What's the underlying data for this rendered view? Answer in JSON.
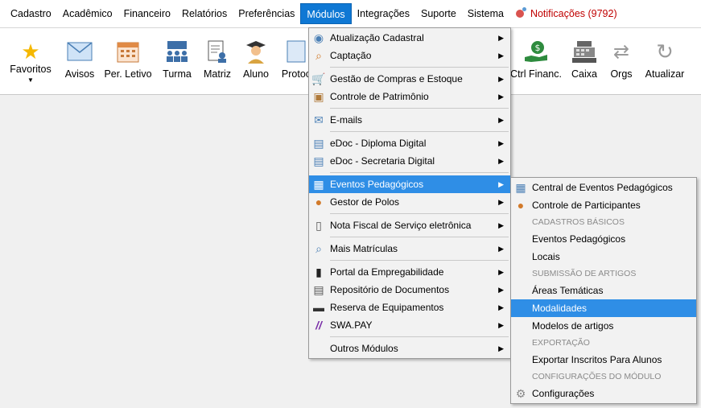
{
  "menubar": {
    "items": [
      "Cadastro",
      "Acadêmico",
      "Financeiro",
      "Relatórios",
      "Preferências",
      "Módulos",
      "Integrações",
      "Suporte",
      "Sistema"
    ],
    "notifications": "Notificações (9792)"
  },
  "toolbar": {
    "buttons": [
      {
        "label": "Favoritos",
        "icon": "star-icon"
      },
      {
        "label": "Avisos",
        "icon": "envelope-icon"
      },
      {
        "label": "Per. Letivo",
        "icon": "calendar-icon"
      },
      {
        "label": "Turma",
        "icon": "classroom-icon"
      },
      {
        "label": "Matriz",
        "icon": "document-user-icon"
      },
      {
        "label": "Aluno",
        "icon": "student-icon"
      },
      {
        "label": "Protoc",
        "icon": "protocol-icon"
      },
      {
        "label": "Ctrl Financ.",
        "icon": "money-hand-icon"
      },
      {
        "label": "Caixa",
        "icon": "cash-register-icon"
      },
      {
        "label": "Orgs",
        "icon": "swap-icon"
      },
      {
        "label": "Atualizar",
        "icon": "refresh-icon"
      }
    ]
  },
  "modulos_menu": {
    "items": [
      {
        "label": "Atualização Cadastral",
        "icon": "database-icon",
        "submenu": true
      },
      {
        "label": "Captação",
        "icon": "magnifier-icon",
        "submenu": true
      },
      {
        "label": "Gestão de Compras e Estoque",
        "icon": "cart-icon",
        "submenu": true
      },
      {
        "label": "Controle de Patrimônio",
        "icon": "box-icon",
        "submenu": true
      },
      {
        "label": "E-mails",
        "icon": "mail-icon",
        "submenu": true
      },
      {
        "label": "eDoc - Diploma Digital",
        "icon": "edoc-icon",
        "submenu": true
      },
      {
        "label": "eDoc - Secretaria Digital",
        "icon": "edoc-icon",
        "submenu": true
      },
      {
        "label": "Eventos Pedagógicos",
        "icon": "calendar-grid-icon",
        "submenu": true
      },
      {
        "label": "Gestor de Polos",
        "icon": "people-icon",
        "submenu": true
      },
      {
        "label": "Nota Fiscal de Serviço eletrônica",
        "icon": "invoice-icon",
        "submenu": true
      },
      {
        "label": "Mais Matrículas",
        "icon": "enroll-icon",
        "submenu": true
      },
      {
        "label": "Portal da Empregabilidade",
        "icon": "cv-icon",
        "submenu": true
      },
      {
        "label": "Repositório de Documentos",
        "icon": "documents-icon",
        "submenu": true
      },
      {
        "label": "Reserva de Equipamentos",
        "icon": "monitor-icon",
        "submenu": true
      },
      {
        "label": "SWA.PAY",
        "icon": "swapay-icon",
        "submenu": true
      },
      {
        "label": "Outros Módulos",
        "icon": "",
        "submenu": true
      }
    ]
  },
  "eventos_submenu": {
    "items": [
      {
        "kind": "item",
        "label": "Central de Eventos Pedagógicos",
        "icon": "calendar-grid-icon"
      },
      {
        "kind": "item",
        "label": "Controle de Participantes",
        "icon": "participants-icon"
      },
      {
        "kind": "section",
        "label": "CADASTROS BÁSICOS"
      },
      {
        "kind": "item",
        "label": "Eventos Pedagógicos",
        "icon": ""
      },
      {
        "kind": "item",
        "label": "Locais",
        "icon": ""
      },
      {
        "kind": "section",
        "label": "SUBMISSÃO DE ARTIGOS"
      },
      {
        "kind": "item",
        "label": "Áreas Temáticas",
        "icon": ""
      },
      {
        "kind": "item",
        "label": "Modalidades",
        "icon": ""
      },
      {
        "kind": "item",
        "label": "Modelos de artigos",
        "icon": ""
      },
      {
        "kind": "section",
        "label": "EXPORTAÇÃO"
      },
      {
        "kind": "item",
        "label": "Exportar Inscritos Para Alunos",
        "icon": ""
      },
      {
        "kind": "section",
        "label": "CONFIGURAÇÕES DO MÓDULO"
      },
      {
        "kind": "item",
        "label": "Configurações",
        "icon": "gear-icon"
      }
    ]
  }
}
